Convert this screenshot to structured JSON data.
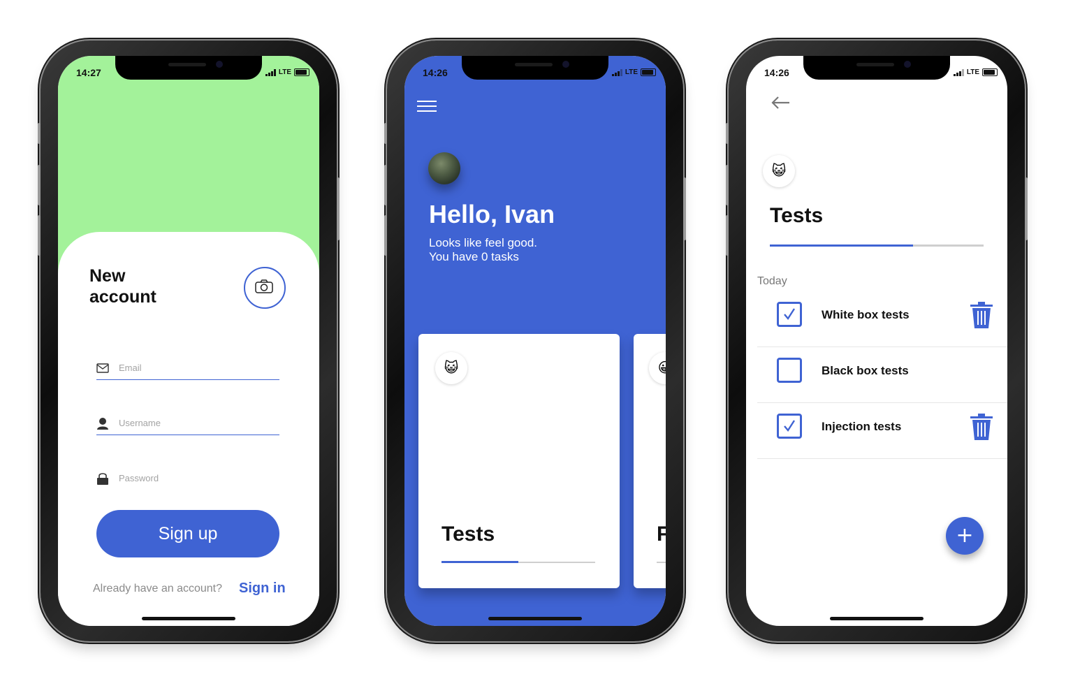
{
  "phones": [
    {
      "status": {
        "time": "14:27",
        "network": "LTE"
      },
      "title_line1": "New",
      "title_line2": "account",
      "email_placeholder": "Email",
      "username_placeholder": "Username",
      "password_placeholder": "Password",
      "signup_label": "Sign up",
      "already_text": "Already have an account?",
      "signin_label": "Sign in"
    },
    {
      "status": {
        "time": "14:26",
        "network": "LTE"
      },
      "greeting": "Hello, Ivan",
      "subtitle_line1": "Looks like feel good.",
      "subtitle_line2": "You have 0 tasks",
      "cards": [
        {
          "emoji": "😺",
          "title": "Tests",
          "progress": 0.5
        },
        {
          "emoji": "😀",
          "title": "F",
          "progress": 0.0
        }
      ]
    },
    {
      "status": {
        "time": "14:26",
        "network": "LTE"
      },
      "emoji": "😺",
      "title": "Tests",
      "progress": 0.67,
      "section_label": "Today",
      "tasks": [
        {
          "label": "White box tests",
          "checked": true
        },
        {
          "label": "Black box tests",
          "checked": false
        },
        {
          "label": "Injection tests",
          "checked": true
        }
      ],
      "fab_label": "+"
    }
  ],
  "colors": {
    "accent": "#3f63d3",
    "green": "#a3f29a"
  }
}
